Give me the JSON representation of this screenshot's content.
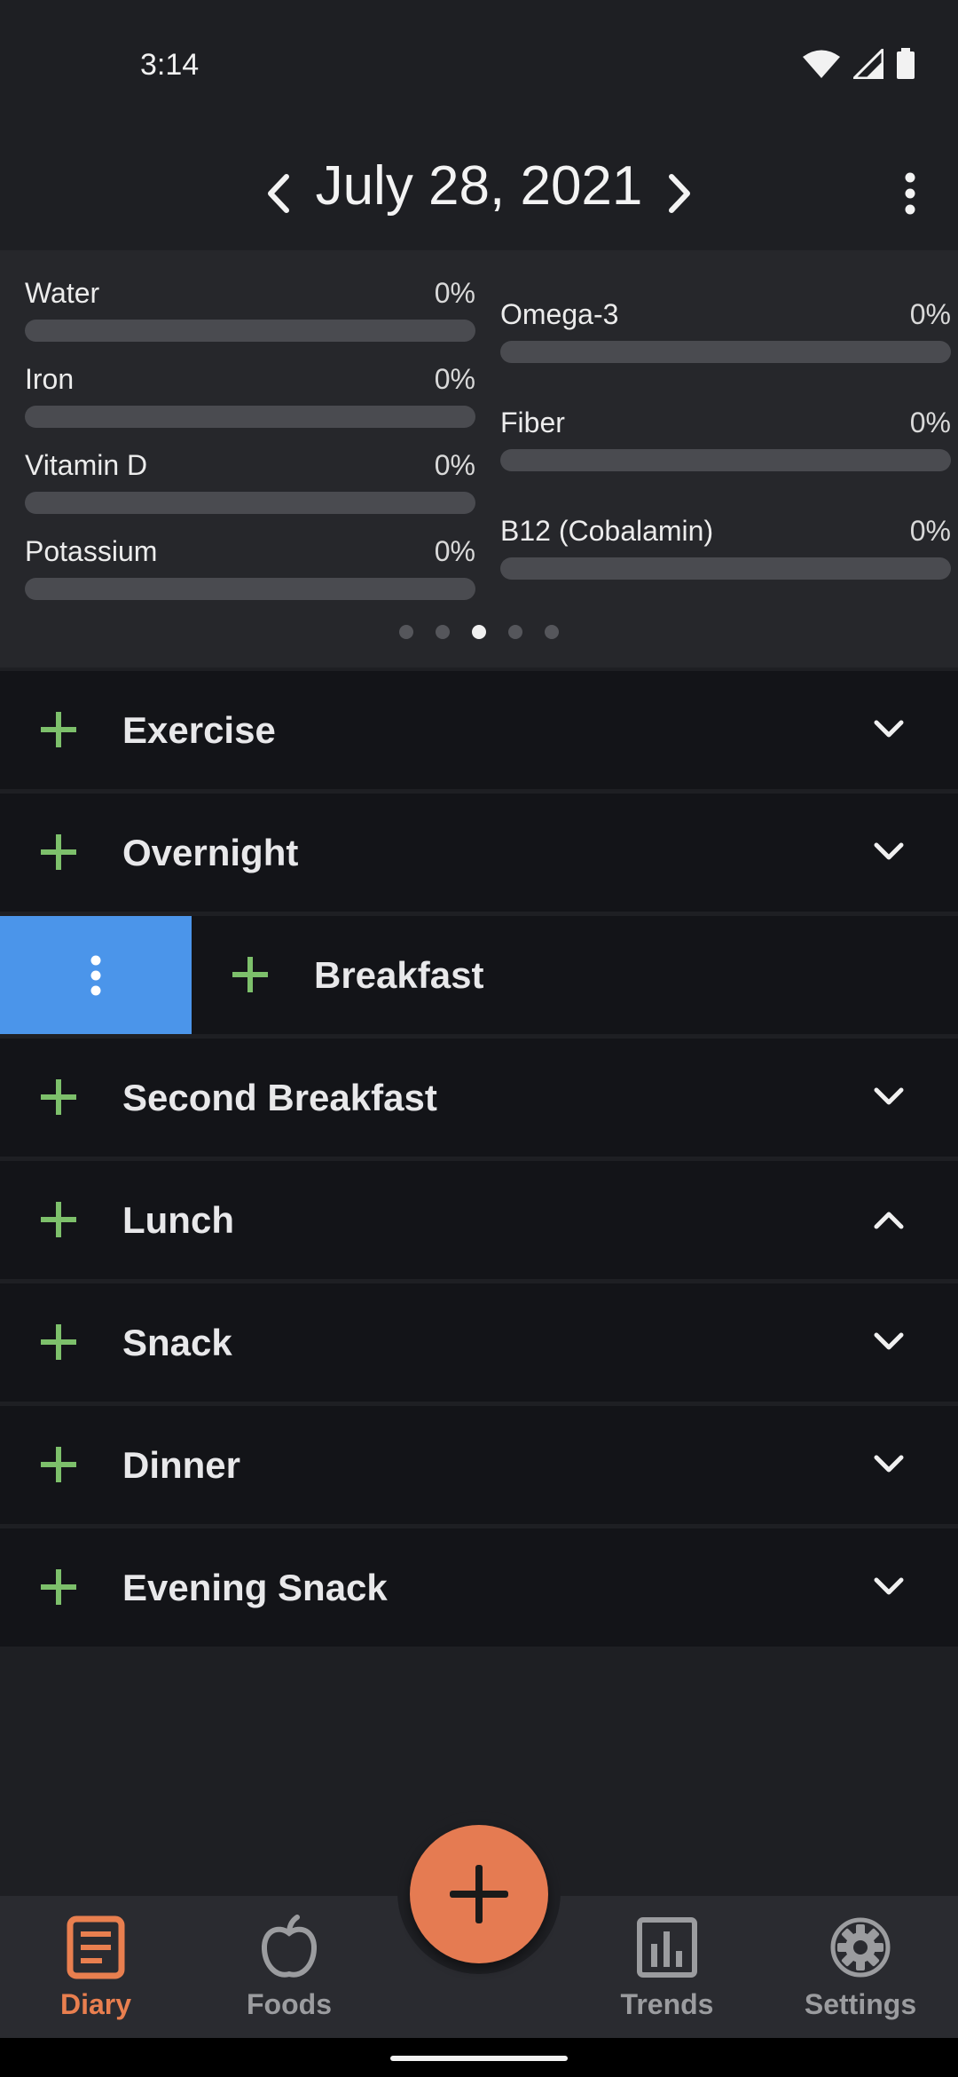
{
  "status_bar": {
    "time": "3:14"
  },
  "header": {
    "date": "July 28, 2021"
  },
  "nutrients": {
    "left": [
      {
        "name": "Water",
        "percent_label": "0%",
        "progress": 0
      },
      {
        "name": "Iron",
        "percent_label": "0%",
        "progress": 0
      },
      {
        "name": "Vitamin D",
        "percent_label": "0%",
        "progress": 0
      },
      {
        "name": "Potassium",
        "percent_label": "0%",
        "progress": 0
      }
    ],
    "right": [
      {
        "name": "Omega-3",
        "percent_label": "0%",
        "progress": 0
      },
      {
        "name": "Fiber",
        "percent_label": "0%",
        "progress": 0
      },
      {
        "name": "B12 (Cobalamin)",
        "percent_label": "0%",
        "progress": 0
      }
    ],
    "pager": {
      "pages": 5,
      "active_page": 3
    }
  },
  "meals": [
    {
      "title": "Exercise",
      "state": "collapsed"
    },
    {
      "title": "Overnight",
      "state": "collapsed"
    },
    {
      "title": "Breakfast",
      "state": "swiped"
    },
    {
      "title": "Second Breakfast",
      "state": "collapsed"
    },
    {
      "title": "Lunch",
      "state": "expanded"
    },
    {
      "title": "Snack",
      "state": "collapsed"
    },
    {
      "title": "Dinner",
      "state": "collapsed"
    },
    {
      "title": "Evening Snack",
      "state": "collapsed"
    }
  ],
  "bottom_nav": {
    "items": [
      {
        "label": "Diary",
        "icon": "diary-icon",
        "active": true
      },
      {
        "label": "Foods",
        "icon": "apple-icon",
        "active": false
      },
      {
        "label": "Trends",
        "icon": "chart-icon",
        "active": false
      },
      {
        "label": "Settings",
        "icon": "gear-icon",
        "active": false
      }
    ]
  },
  "colors": {
    "accent": "#e57b52",
    "add_icon": "#7dc06b",
    "swipe_action": "#4b95ea",
    "background": "#1e1f23",
    "meal_row": "#131418"
  }
}
